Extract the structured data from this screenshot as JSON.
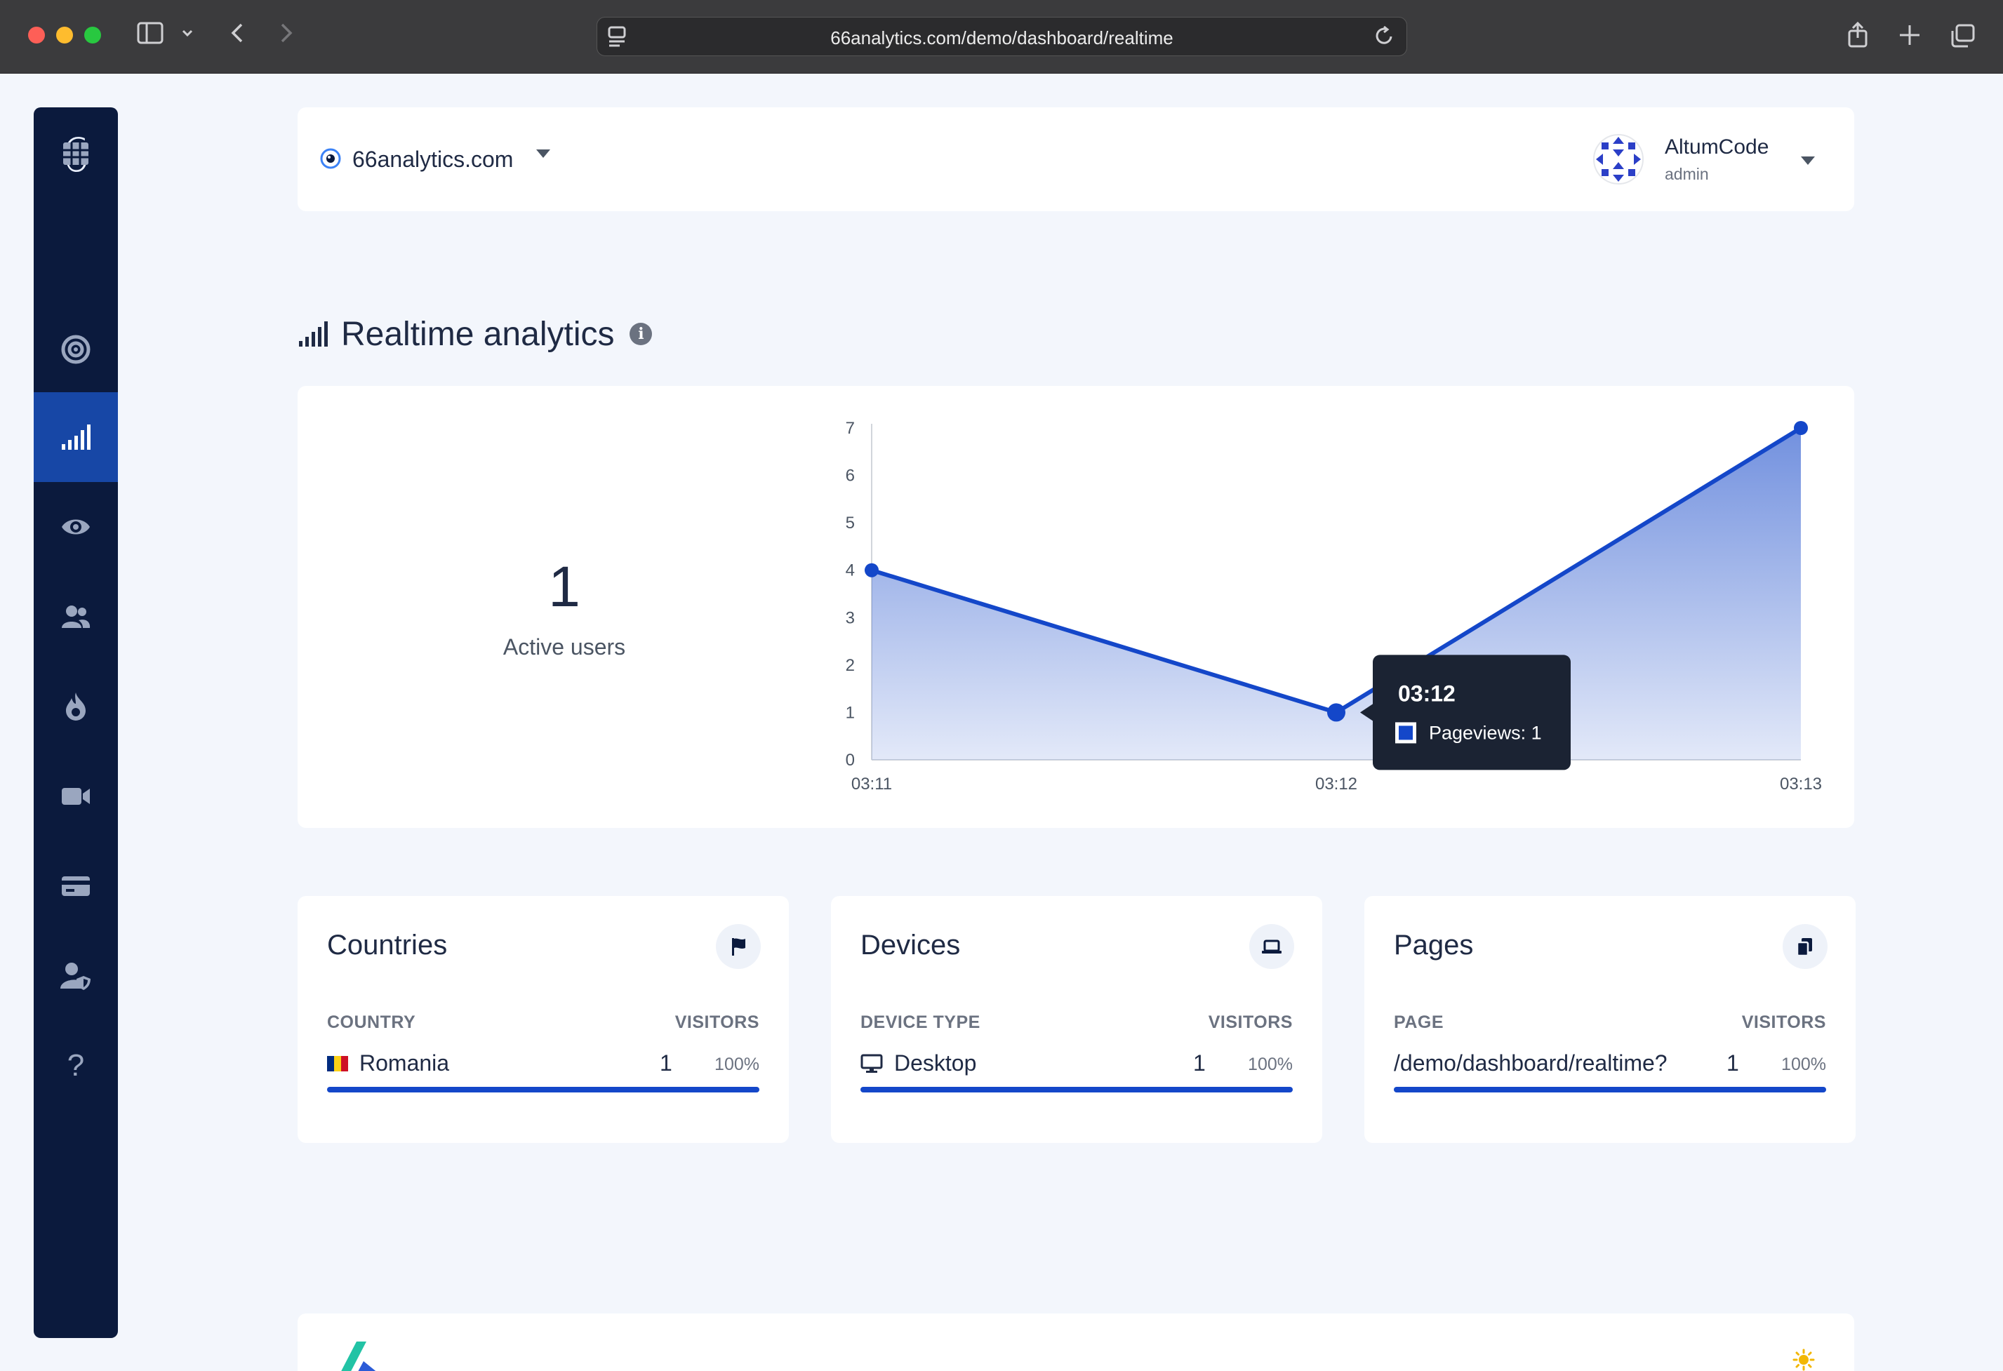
{
  "browser": {
    "url": "66analytics.com/demo/dashboard/realtime"
  },
  "sidebar": {
    "logo": "6",
    "items": [
      {
        "icon": "grid-icon",
        "active": false
      },
      {
        "icon": "target-icon",
        "active": false
      },
      {
        "icon": "signal-bars-icon",
        "active": true
      },
      {
        "icon": "eye-icon",
        "active": false
      },
      {
        "icon": "users-icon",
        "active": false
      },
      {
        "icon": "fire-icon",
        "active": false
      },
      {
        "icon": "video-camera-icon",
        "active": false
      },
      {
        "icon": "credit-card-icon",
        "active": false
      },
      {
        "icon": "user-shield-icon",
        "active": false
      },
      {
        "icon": "question-icon",
        "active": false
      }
    ],
    "help_glyph": "?"
  },
  "header": {
    "site_name": "66analytics.com",
    "user_name": "AltumCode",
    "user_role": "admin"
  },
  "section": {
    "title": "Realtime analytics",
    "info_glyph": "i"
  },
  "realtime": {
    "active_users": "1",
    "active_users_label": "Active users"
  },
  "chart_data": {
    "type": "area",
    "x": [
      "03:11",
      "03:12",
      "03:13"
    ],
    "series": [
      {
        "name": "Pageviews",
        "values": [
          4,
          1,
          7
        ]
      }
    ],
    "ylim": [
      0,
      7
    ],
    "yticks": [
      0,
      1,
      2,
      3,
      4,
      5,
      6,
      7
    ],
    "grid": false,
    "accent": "#1447c9",
    "tooltip": {
      "title": "03:12",
      "label": "Pageviews: 1"
    }
  },
  "stats": [
    {
      "title": "Countries",
      "icon": "flag-icon",
      "col_label": "COUNTRY",
      "col_value": "VISITORS",
      "row": {
        "label": "Romania",
        "count": "1",
        "percent": "100%",
        "share": 1.0
      }
    },
    {
      "title": "Devices",
      "icon": "laptop-icon",
      "col_label": "DEVICE TYPE",
      "col_value": "VISITORS",
      "row": {
        "label": "Desktop",
        "count": "1",
        "percent": "100%",
        "share": 1.0
      }
    },
    {
      "title": "Pages",
      "icon": "copy-icon",
      "col_label": "PAGE",
      "col_value": "VISITORS",
      "row": {
        "label": "/demo/dashboard/realtime?",
        "count": "1",
        "percent": "100%",
        "share": 1.0
      }
    }
  ],
  "colors": {
    "sidebar_bg": "#0b1a3d",
    "sidebar_active": "#1747a6",
    "accent": "#1447c9",
    "page_bg": "#f3f6fc"
  }
}
